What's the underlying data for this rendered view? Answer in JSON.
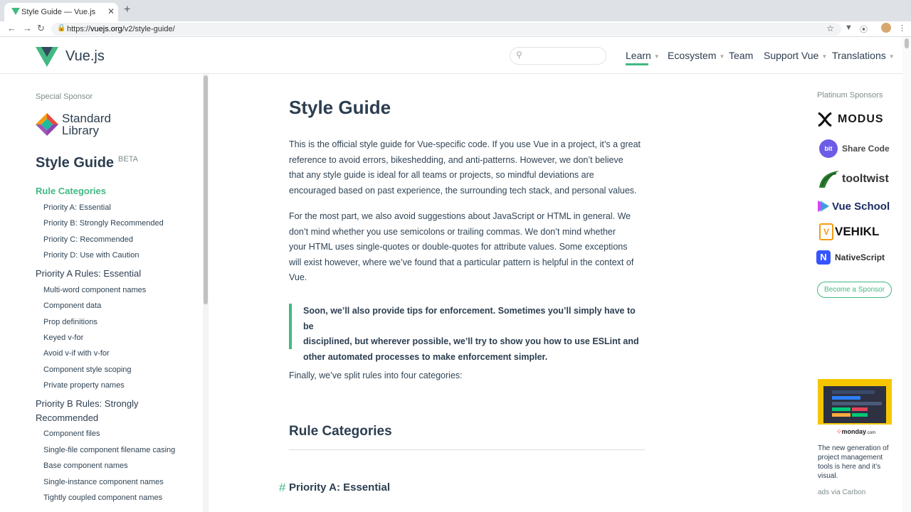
{
  "browser": {
    "tab_title": "Style Guide — Vue.js",
    "tab_close": "✕",
    "new_tab": "+",
    "url_scheme": "https://",
    "url_domain": "vuejs.org",
    "url_path": "/v2/style-guide/"
  },
  "header": {
    "logo_text": "Vue.js",
    "nav": [
      {
        "label": "Learn"
      },
      {
        "label": "Ecosystem"
      },
      {
        "label": "Team"
      },
      {
        "label": "Support Vue"
      },
      {
        "label": "Translations"
      }
    ]
  },
  "sidebar": {
    "special_sponsor": "Special Sponsor",
    "sponsor_line1": "Standard",
    "sponsor_line2": "Library",
    "title": "Style Guide",
    "title_badge": "BETA",
    "sections": [
      {
        "label": "Rule Categories"
      },
      {
        "label": "Priority A: Essential"
      },
      {
        "label": "Priority B: Strongly Recommended"
      },
      {
        "label": "Priority C: Recommended"
      },
      {
        "label": "Priority D: Use with Caution"
      },
      {
        "label": "Priority A Rules: Essential"
      },
      {
        "label": "Multi-word component names"
      },
      {
        "label": "Component data"
      },
      {
        "label": "Prop definitions"
      },
      {
        "label": "Keyed v-for"
      },
      {
        "label": "Avoid v-if with v-for"
      },
      {
        "label": "Component style scoping"
      },
      {
        "label": "Private property names"
      },
      {
        "label": "Priority B Rules: Strongly"
      },
      {
        "label": "Recommended"
      },
      {
        "label": "Component files"
      },
      {
        "label": "Single-file component filename casing"
      },
      {
        "label": "Base component names"
      },
      {
        "label": "Single-instance component names"
      },
      {
        "label": "Tightly coupled component names"
      }
    ]
  },
  "content": {
    "title": "Style Guide",
    "p1": [
      "This is the official style guide for Vue-specific code. If you use Vue in a project, it’s a great",
      "reference to avoid errors, bikeshedding, and anti-patterns. However, we don’t believe",
      "that any style guide is ideal for all teams or projects, so mindful deviations are",
      "encouraged based on past experience, the surrounding tech stack, and personal values."
    ],
    "p2": [
      "For the most part, we also avoid suggestions about JavaScript or HTML in general. We",
      "don’t mind whether you use semicolons or trailing commas. We don’t mind whether",
      "your HTML uses single-quotes or double-quotes for attribute values. Some exceptions",
      "will exist however, where we’ve found that a particular pattern is helpful in the context of",
      "Vue."
    ],
    "tip": [
      "Soon, we’ll also provide tips for enforcement. Sometimes you’ll simply have to be",
      "disciplined, but wherever possible, we’ll try to show you how to use ESLint and",
      "other automated processes to make enforcement simpler."
    ],
    "p3": "Finally, we’ve split rules into four categories:",
    "h2": "Rule Categories",
    "h3_hash": "#",
    "h3": "Priority A: Essential"
  },
  "sponsors": {
    "heading": "Platinum Sponsors",
    "list": [
      {
        "name": "MODUS"
      },
      {
        "name": "Share Code"
      },
      {
        "name": "tooltwist"
      },
      {
        "name": "Vue School"
      },
      {
        "name": "VEHIKL"
      },
      {
        "name": "NativeScript"
      }
    ],
    "become": "Become a Sponsor",
    "ad_brand": "monday",
    "ad_brand_suffix": ".com",
    "ad_text": "The new generation of project management tools is here and it’s visual.",
    "ads_via": "ads via Carbon"
  },
  "colors": {
    "accent": "#42b983",
    "text": "#2c3e50"
  }
}
